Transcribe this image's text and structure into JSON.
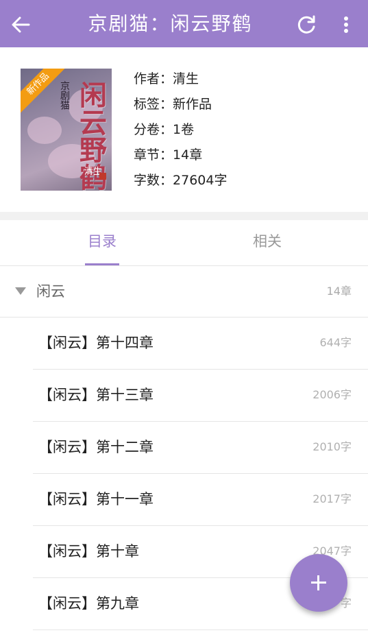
{
  "appbar": {
    "title": "京剧猫：闲云野鹤",
    "back_icon": "arrow-left-icon",
    "refresh_icon": "refresh-icon",
    "more_icon": "more-vertical-icon",
    "color": "#9a7fcc"
  },
  "book": {
    "cover": {
      "ribbon": "新作品",
      "big_title": "闲云野鹤",
      "small_title": "京剧猫",
      "author_mark": "清生"
    },
    "meta": [
      {
        "label": "作者：",
        "value": "清生"
      },
      {
        "label": "标签：",
        "value": "新作品"
      },
      {
        "label": "分卷：",
        "value": "1卷"
      },
      {
        "label": "章节：",
        "value": "14章"
      },
      {
        "label": "字数：",
        "value": "27604字"
      }
    ]
  },
  "tabs": [
    {
      "label": "目录",
      "active": true
    },
    {
      "label": "相关",
      "active": false
    }
  ],
  "volume": {
    "name": "闲云",
    "count": "14章"
  },
  "chapters": [
    {
      "name": "【闲云】第十四章",
      "words": "644字"
    },
    {
      "name": "【闲云】第十三章",
      "words": "2006字"
    },
    {
      "name": "【闲云】第十二章",
      "words": "2010字"
    },
    {
      "name": "【闲云】第十一章",
      "words": "2017字"
    },
    {
      "name": "【闲云】第十章",
      "words": "2047字"
    },
    {
      "name": "【闲云】第九章",
      "words": "字"
    }
  ],
  "fab": {
    "icon": "plus-icon"
  }
}
